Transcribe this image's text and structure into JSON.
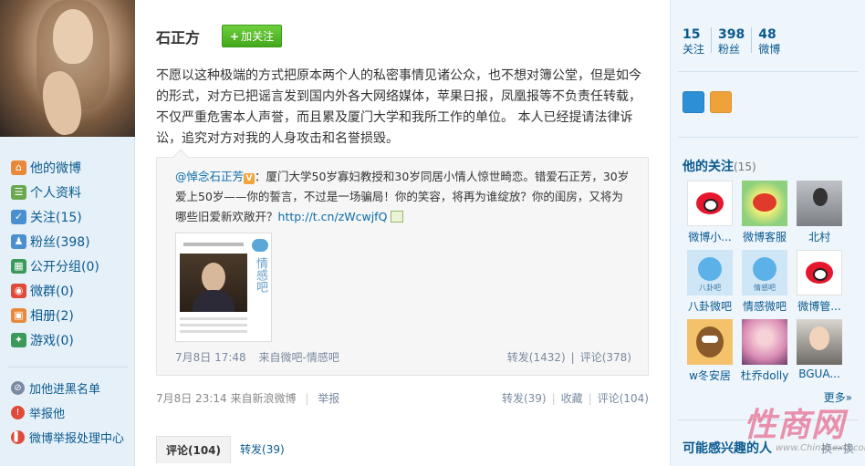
{
  "profile": {
    "name": "石正方",
    "follow_button": "加关注"
  },
  "left_nav": {
    "items": [
      {
        "label": "他的微博",
        "icon": "home-icon",
        "color": "#e8883a"
      },
      {
        "label": "个人资料",
        "icon": "profile-card-icon",
        "color": "#6aa84f"
      },
      {
        "label": "关注(15)",
        "icon": "follow-icon",
        "color": "#4a90d0"
      },
      {
        "label": "粉丝(398)",
        "icon": "fans-icon",
        "color": "#4a90d0"
      },
      {
        "label": "公开分组(0)",
        "icon": "group-icon",
        "color": "#3a9a5a"
      },
      {
        "label": "微群(0)",
        "icon": "weiqun-icon",
        "color": "#e04a3a"
      },
      {
        "label": "相册(2)",
        "icon": "album-icon",
        "color": "#e8883a"
      },
      {
        "label": "游戏(0)",
        "icon": "game-icon",
        "color": "#3a9a5a"
      }
    ],
    "secondary": [
      {
        "label": "加他进黑名单",
        "icon": "blacklist-icon",
        "color": "#7a8aa0"
      },
      {
        "label": "举报他",
        "icon": "report-icon",
        "color": "#e04a3a"
      },
      {
        "label": "微博举报处理中心",
        "icon": "report-center-icon",
        "color": "#e04a3a"
      }
    ]
  },
  "post": {
    "text": "不愿以这种极端的方式把原本两个人的私密事情见诸公众，也不想对簿公堂，但是如今的形式，对方已把谣言发到国内外各大网络媒体，苹果日报，凤凰报等不负责任转载，不仅严重危害本人声誉，而且累及厦门大学和我所工作的单位。 本人已经提请法律诉讼，追究对方对我的人身攻击和名誉损毁。",
    "time": "7月8日 23:14",
    "source": "来自新浪微博",
    "report": "举报",
    "repost": "转发(39)",
    "favorite": "收藏",
    "comment": "评论(104)"
  },
  "repost": {
    "author": "@悼念石正芳",
    "badge": "V",
    "text": "：厦门大学50岁寡妇教授和30岁同居小情人惊世畸恋。错爱石正芳，30岁爱上50岁——你的誓言，不过是一场骗局！你的笑容，将再为谁绽放？你的闺房，又将为哪些旧爱新欢敞开？",
    "link": "http://t.cn/zWcwjfQ",
    "thumb_side_label": "情感吧",
    "time": "7月8日 17:48",
    "source": "来自微吧-情感吧",
    "repost": "转发(1432)",
    "comment": "评论(378)"
  },
  "tabs": [
    {
      "label": "评论(104)",
      "active": true
    },
    {
      "label": "转发(39)",
      "active": false
    }
  ],
  "stats": [
    {
      "num": "15",
      "label": "关注"
    },
    {
      "num": "398",
      "label": "粉丝"
    },
    {
      "num": "48",
      "label": "微博"
    }
  ],
  "follows": {
    "title": "他的关注",
    "count": "(15)",
    "items": [
      {
        "name": "微博小...",
        "avatar": "weibo"
      },
      {
        "name": "微博客服",
        "avatar": "green"
      },
      {
        "name": "北村",
        "avatar": "gray"
      },
      {
        "name": "八卦微吧",
        "avatar": "blue",
        "tag": "八卦吧"
      },
      {
        "name": "情感微吧",
        "avatar": "blue",
        "tag": "情感吧"
      },
      {
        "name": "微博管...",
        "avatar": "weibo"
      },
      {
        "name": "w冬安居",
        "avatar": "cartoon"
      },
      {
        "name": "杜乔dolly",
        "avatar": "pink"
      },
      {
        "name": "BGUA...",
        "avatar": "boy"
      }
    ],
    "more": "更多»"
  },
  "maybe": {
    "title": "可能感兴趣的人",
    "swap": "换一换"
  },
  "watermark": {
    "main": "性商网",
    "sub": "www.ChinaSexQ.com"
  }
}
